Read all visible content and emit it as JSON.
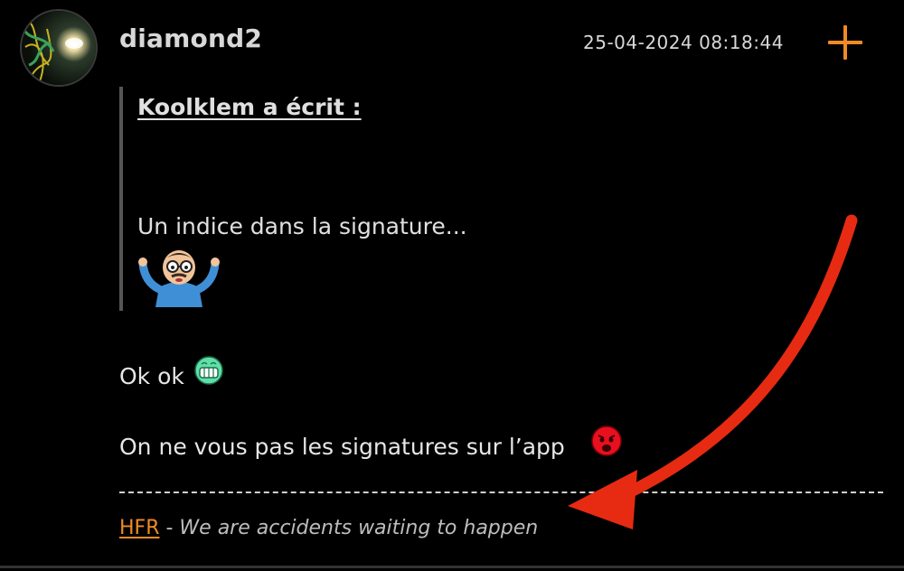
{
  "post": {
    "username": "diamond2",
    "timestamp": "25-04-2024 08:18:44",
    "quote": {
      "author": "Koolklem a écrit :",
      "text": "Un indice dans la signature..."
    },
    "lines": [
      "Ok ok",
      "On ne vous pas les signatures sur l’app"
    ],
    "signature": {
      "link": "HFR",
      "separator": " - ",
      "text": "We are accidents waiting to happen"
    }
  },
  "icons": {
    "add": "plus-icon",
    "quote_smiley": "shrug-smiley-icon",
    "smiley_1": "grin-smiley-icon",
    "smiley_2": "angry-smiley-icon",
    "annotation": "red-arrow-annotation"
  },
  "colors": {
    "background": "#000000",
    "accent": "#f08a24",
    "text": "#e6e6e6",
    "annotation": "#e62b12"
  }
}
